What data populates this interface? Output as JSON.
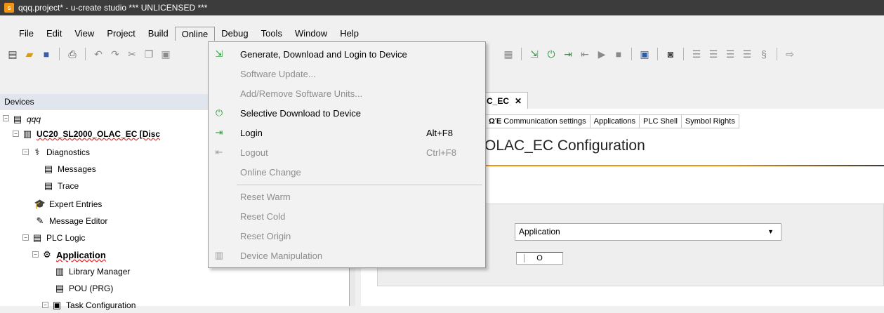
{
  "window": {
    "title": "qqq.project* - u-create studio *** UNLICENSED ***",
    "app_icon_letter": "s"
  },
  "menubar": {
    "items": [
      {
        "label": "File"
      },
      {
        "label": "Edit"
      },
      {
        "label": "View"
      },
      {
        "label": "Project"
      },
      {
        "label": "Build"
      },
      {
        "label": "Online",
        "active": true
      },
      {
        "label": "Debug"
      },
      {
        "label": "Tools"
      },
      {
        "label": "Window"
      },
      {
        "label": "Help"
      }
    ]
  },
  "online_menu": {
    "items": [
      {
        "label": "Generate, Download and Login to Device",
        "shortcut": "",
        "enabled": true,
        "icon": "generate-download-login-icon"
      },
      {
        "label": "Software Update...",
        "shortcut": "",
        "enabled": false,
        "icon": ""
      },
      {
        "label": "Add/Remove Software Units...",
        "shortcut": "",
        "enabled": false,
        "icon": ""
      },
      {
        "label": "Selective Download to Device",
        "shortcut": "",
        "enabled": true,
        "icon": "selective-download-icon"
      },
      {
        "label": "Login",
        "shortcut": "Alt+F8",
        "enabled": true,
        "icon": "login-icon"
      },
      {
        "label": "Logout",
        "shortcut": "Ctrl+F8",
        "enabled": false,
        "icon": "logout-icon"
      },
      {
        "label": "Online Change",
        "shortcut": "",
        "enabled": false,
        "icon": ""
      },
      {
        "label": "Reset Warm",
        "shortcut": "",
        "enabled": false,
        "icon": ""
      },
      {
        "label": "Reset Cold",
        "shortcut": "",
        "enabled": false,
        "icon": ""
      },
      {
        "label": "Reset Origin",
        "shortcut": "",
        "enabled": false,
        "icon": ""
      },
      {
        "label": "Device Manipulation",
        "shortcut": "",
        "enabled": false,
        "icon": "device-manipulation-icon"
      }
    ]
  },
  "devices": {
    "header": "Devices",
    "tree": [
      {
        "label": "qqq",
        "icon": "project-icon",
        "italic": true
      },
      {
        "label": "UC20_SL2000_OLAC_EC [Disc",
        "icon": "device-icon",
        "bold": true
      },
      {
        "label": "Diagnostics",
        "icon": "diagnostics-icon"
      },
      {
        "label": "Messages",
        "icon": "messages-icon"
      },
      {
        "label": "Trace",
        "icon": "trace-icon"
      },
      {
        "label": "Expert Entries",
        "icon": "expert-entries-icon"
      },
      {
        "label": "Message Editor",
        "icon": "message-editor-icon"
      },
      {
        "label": "PLC Logic",
        "icon": "plc-logic-icon"
      },
      {
        "label": "Application",
        "icon": "application-icon",
        "bold": true
      },
      {
        "label": "Library Manager",
        "icon": "library-manager-icon"
      },
      {
        "label": "POU (PRG)",
        "icon": "pou-icon"
      },
      {
        "label": "Task Configuration",
        "icon": "task-configuration-icon"
      }
    ]
  },
  "editor": {
    "tab_label": "C_EC",
    "subtabs": [
      {
        "label": "Communication settings",
        "icon": "communication-settings-icon"
      },
      {
        "label": "Applications"
      },
      {
        "label": "PLC Shell"
      },
      {
        "label": "Symbol Rights"
      }
    ],
    "title": "OLAC_EC Configuration",
    "application_select": "Application",
    "toggle_label": "O"
  },
  "colors": {
    "accent": "#f29312",
    "titlebar": "#3c3c3c",
    "online_green": "#2a9d3a"
  }
}
